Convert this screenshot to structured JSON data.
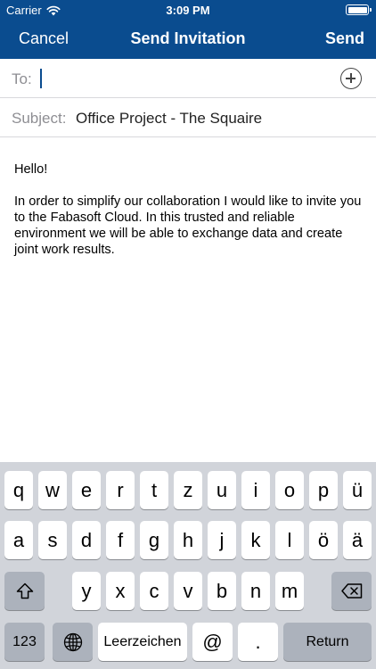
{
  "status_bar": {
    "carrier": "Carrier",
    "time": "3:09 PM"
  },
  "nav": {
    "cancel": "Cancel",
    "title": "Send Invitation",
    "send": "Send"
  },
  "to_field": {
    "label": "To:",
    "value": ""
  },
  "subject_field": {
    "label": "Subject:",
    "value": "Office Project - The Squaire"
  },
  "message": {
    "greeting": "Hello!",
    "body": "In order to simplify our collaboration I would like to invite you to the Fabasoft Cloud. In this trusted and reliable environment we will be able to exchange data and create joint work results."
  },
  "keyboard": {
    "row1": [
      "q",
      "w",
      "e",
      "r",
      "t",
      "z",
      "u",
      "i",
      "o",
      "p",
      "ü"
    ],
    "row2": [
      "a",
      "s",
      "d",
      "f",
      "g",
      "h",
      "j",
      "k",
      "l",
      "ö",
      "ä"
    ],
    "row3": [
      "y",
      "x",
      "c",
      "v",
      "b",
      "n",
      "m"
    ],
    "numbers_key": "123",
    "space_key": "Leerzeichen",
    "at_key": "@",
    "period_key": ".",
    "return_key": "Return"
  }
}
